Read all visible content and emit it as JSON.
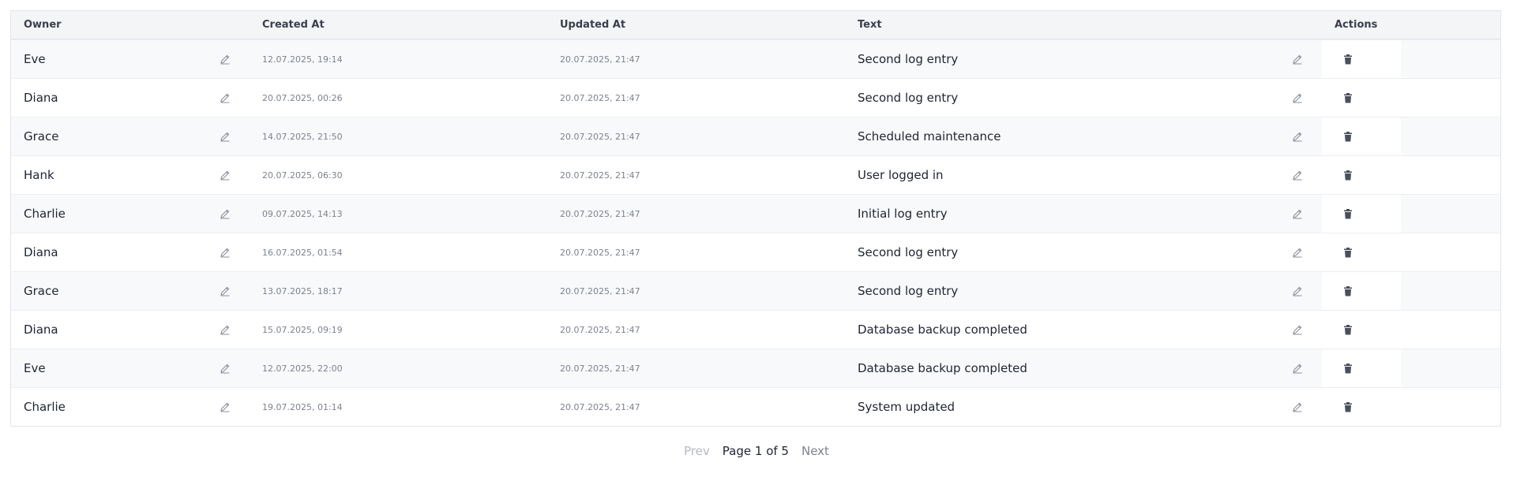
{
  "table": {
    "headers": {
      "owner": "Owner",
      "created_at": "Created At",
      "updated_at": "Updated At",
      "text": "Text",
      "actions": "Actions"
    },
    "rows": [
      {
        "owner": "Eve",
        "created_at": "12.07.2025, 19:14",
        "updated_at": "20.07.2025, 21:47",
        "text": "Second log entry"
      },
      {
        "owner": "Diana",
        "created_at": "20.07.2025, 00:26",
        "updated_at": "20.07.2025, 21:47",
        "text": "Second log entry"
      },
      {
        "owner": "Grace",
        "created_at": "14.07.2025, 21:50",
        "updated_at": "20.07.2025, 21:47",
        "text": "Scheduled maintenance"
      },
      {
        "owner": "Hank",
        "created_at": "20.07.2025, 06:30",
        "updated_at": "20.07.2025, 21:47",
        "text": "User logged in"
      },
      {
        "owner": "Charlie",
        "created_at": "09.07.2025, 14:13",
        "updated_at": "20.07.2025, 21:47",
        "text": "Initial log entry"
      },
      {
        "owner": "Diana",
        "created_at": "16.07.2025, 01:54",
        "updated_at": "20.07.2025, 21:47",
        "text": "Second log entry"
      },
      {
        "owner": "Grace",
        "created_at": "13.07.2025, 18:17",
        "updated_at": "20.07.2025, 21:47",
        "text": "Second log entry"
      },
      {
        "owner": "Diana",
        "created_at": "15.07.2025, 09:19",
        "updated_at": "20.07.2025, 21:47",
        "text": "Database backup completed"
      },
      {
        "owner": "Eve",
        "created_at": "12.07.2025, 22:00",
        "updated_at": "20.07.2025, 21:47",
        "text": "Database backup completed"
      },
      {
        "owner": "Charlie",
        "created_at": "19.07.2025, 01:14",
        "updated_at": "20.07.2025, 21:47",
        "text": "System updated"
      }
    ],
    "icons": {
      "edit": "pencil-icon",
      "delete": "trash-icon"
    }
  },
  "pagination": {
    "prev_label": "Prev",
    "page_info": "Page 1 of 5",
    "next_label": "Next"
  },
  "colors": {
    "header_bg": "#f4f5f7",
    "row_alt_bg": "#f8f9fa",
    "border": "#e3e5ea",
    "muted_text": "#7d8290",
    "disabled_text": "#b4b8c2"
  }
}
